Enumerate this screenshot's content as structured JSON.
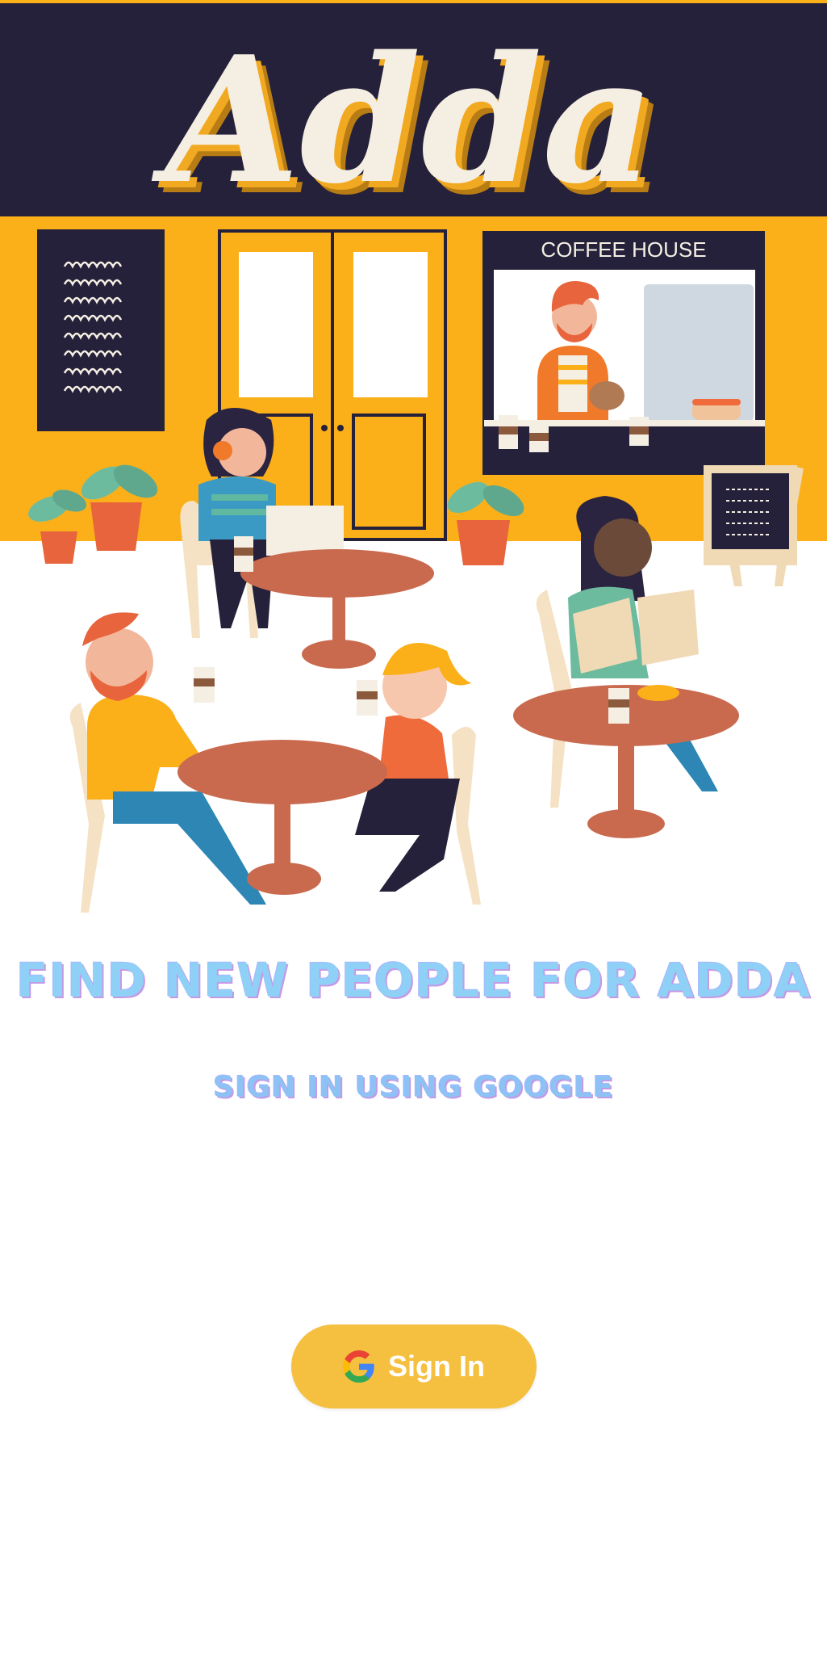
{
  "app": {
    "logo_text": "Adda"
  },
  "hero": {
    "shop_sign": "COFFEE HOUSE"
  },
  "content": {
    "headline": "FIND NEW PEOPLE FOR ADDA",
    "subheadline": "SIGN IN USING GOOGLE"
  },
  "signin_button": {
    "label": "Sign In",
    "icon": "google-g-icon"
  },
  "colors": {
    "navy": "#25213a",
    "mustard": "#fbb019",
    "button": "#f5c03f",
    "headline": "#8fd0f6"
  }
}
